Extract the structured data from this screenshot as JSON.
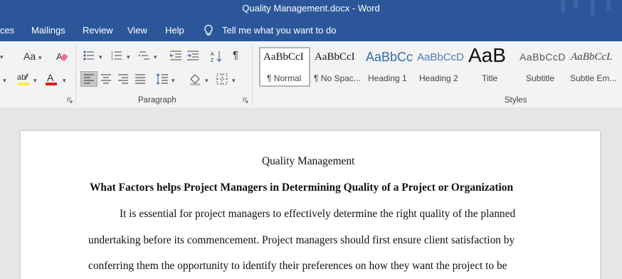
{
  "window": {
    "title": "Quality Management.docx  -  Word"
  },
  "menu": {
    "items": [
      "ces",
      "Mailings",
      "Review",
      "View",
      "Help"
    ],
    "tell_me": "Tell me what you want to do"
  },
  "ribbon": {
    "font_case_label": "Aa",
    "paragraph_label": "Paragraph",
    "styles_label": "Styles",
    "styles": [
      {
        "sample": "AaBbCcI",
        "name": "¶ Normal"
      },
      {
        "sample": "AaBbCcI",
        "name": "¶ No Spac..."
      },
      {
        "sample": "AaBbCc",
        "name": "Heading 1"
      },
      {
        "sample": "AaBbCcD",
        "name": "Heading 2"
      },
      {
        "sample": "AaB",
        "name": "Title"
      },
      {
        "sample": "AaBbCcD",
        "name": "Subtitle"
      },
      {
        "sample": "AaBbCcL",
        "name": "Subtle Em..."
      }
    ]
  },
  "document": {
    "title": "Quality Management",
    "heading": "What Factors helps Project Managers in Determining Quality of a Project or Organization",
    "lines": [
      "It is essential for project managers to effectively determine the right quality of the planned",
      "undertaking before its commencement. Project managers should first ensure client satisfaction by",
      "conferring them the opportunity to identify their preferences on how they want the project to be"
    ]
  },
  "colors": {
    "titlebar": "#2b579a",
    "ribbon": "#f3f3f3",
    "canvas": "#e6e6e6",
    "heading1": "#2f6da8",
    "heading2": "#4a7fb4",
    "highlight": "#ffeb3b",
    "font_color_red": "#e02020"
  }
}
